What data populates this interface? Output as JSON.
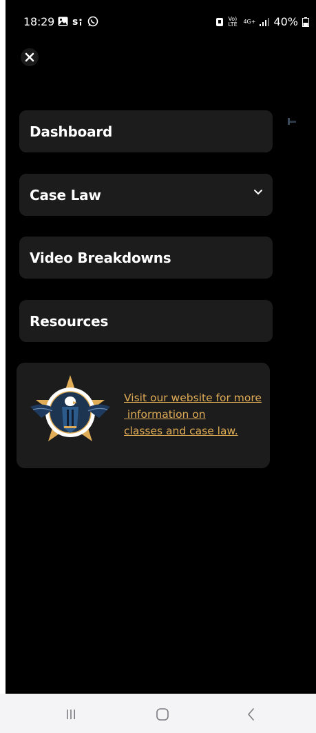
{
  "status_bar": {
    "time": "18:29",
    "battery": "40%",
    "network": "4G+",
    "volte": "Vo) LTE",
    "left_icons": [
      "image-icon",
      "s-notification-icon",
      "whatsapp-icon"
    ]
  },
  "drawer": {
    "close_icon": "close-icon",
    "menu": [
      {
        "label": "Dashboard",
        "has_chevron": false
      },
      {
        "label": "Case Law",
        "has_chevron": true
      },
      {
        "label": "Video Breakdowns",
        "has_chevron": false
      },
      {
        "label": "Resources",
        "has_chevron": false
      }
    ],
    "promo": {
      "link_lines": [
        "Visit our website for more",
        " information on",
        "classes and case law."
      ],
      "link_color": "#e0ad56"
    }
  },
  "nav_bar": {
    "icons": [
      "recent-apps-icon",
      "home-icon",
      "back-icon"
    ]
  },
  "colors": {
    "background": "#000000",
    "card": "#1c1c1c",
    "accent": "#e0ad56",
    "text": "#ffffff"
  }
}
